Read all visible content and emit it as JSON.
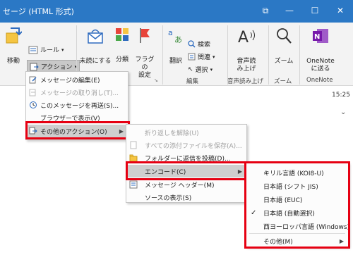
{
  "window": {
    "title": "セージ (HTML 形式)",
    "restore_glyph": "⧉",
    "minimize_glyph": "—",
    "maximize_glyph": "☐",
    "close_glyph": "✕"
  },
  "ribbon": {
    "move": "移動",
    "rules": "ルール",
    "actions": "アクション",
    "unread": "未読にする",
    "categorize": "分類",
    "flag": "フラグの設定",
    "flag_l1": "フラグの",
    "flag_l2": "設定",
    "translate": "翻訳",
    "search": "検索",
    "related": "関連",
    "select": "選択",
    "group_edit": "編集",
    "read_aloud_l1": "音声読",
    "read_aloud_l2": "み上げ",
    "group_read_aloud": "音声読み上げ",
    "zoom": "ズーム",
    "group_zoom": "ズーム",
    "onenote_l1": "OneNote",
    "onenote_l2": "に送る",
    "group_onenote": "OneNote"
  },
  "content": {
    "time": "15:25",
    "expand_glyph": "⌄"
  },
  "actions_menu": {
    "items": [
      {
        "label": "メッセージの編集(E)",
        "disabled": false
      },
      {
        "label": "メッセージの取り消し(T)...",
        "disabled": true
      },
      {
        "label": "このメッセージを再送(S)...",
        "disabled": false
      },
      {
        "label": "ブラウザーで表示(V)",
        "disabled": false
      },
      {
        "label": "その他のアクション(O)",
        "disabled": false
      }
    ]
  },
  "other_actions_menu": {
    "items": [
      {
        "label": "折り返しを解除(U)",
        "disabled": true
      },
      {
        "label": "すべての添付ファイルを保存(A)...",
        "disabled": true
      },
      {
        "label": "フォルダーに返信を投稿(D)...",
        "disabled": false
      },
      {
        "label": "エンコード(C)",
        "disabled": false
      },
      {
        "label": "メッセージ ヘッダー(M)",
        "disabled": false
      },
      {
        "label": "ソースの表示(S)",
        "disabled": false
      }
    ]
  },
  "encoding_menu": {
    "items": [
      {
        "label": "キリル言語 (KOI8-U)",
        "checked": false
      },
      {
        "label": "日本語 (シフト JIS)",
        "checked": false
      },
      {
        "label": "日本語 (EUC)",
        "checked": false
      },
      {
        "label": "日本語 (自動選択)",
        "checked": true
      },
      {
        "label": "西ヨーロッパ言語 (Windows)",
        "checked": false
      },
      {
        "label": "その他(M)",
        "checked": false
      }
    ]
  },
  "colors": {
    "titlebar": "#2b78c5",
    "highlight_border": "#e60012",
    "onenote": "#7719aa"
  }
}
